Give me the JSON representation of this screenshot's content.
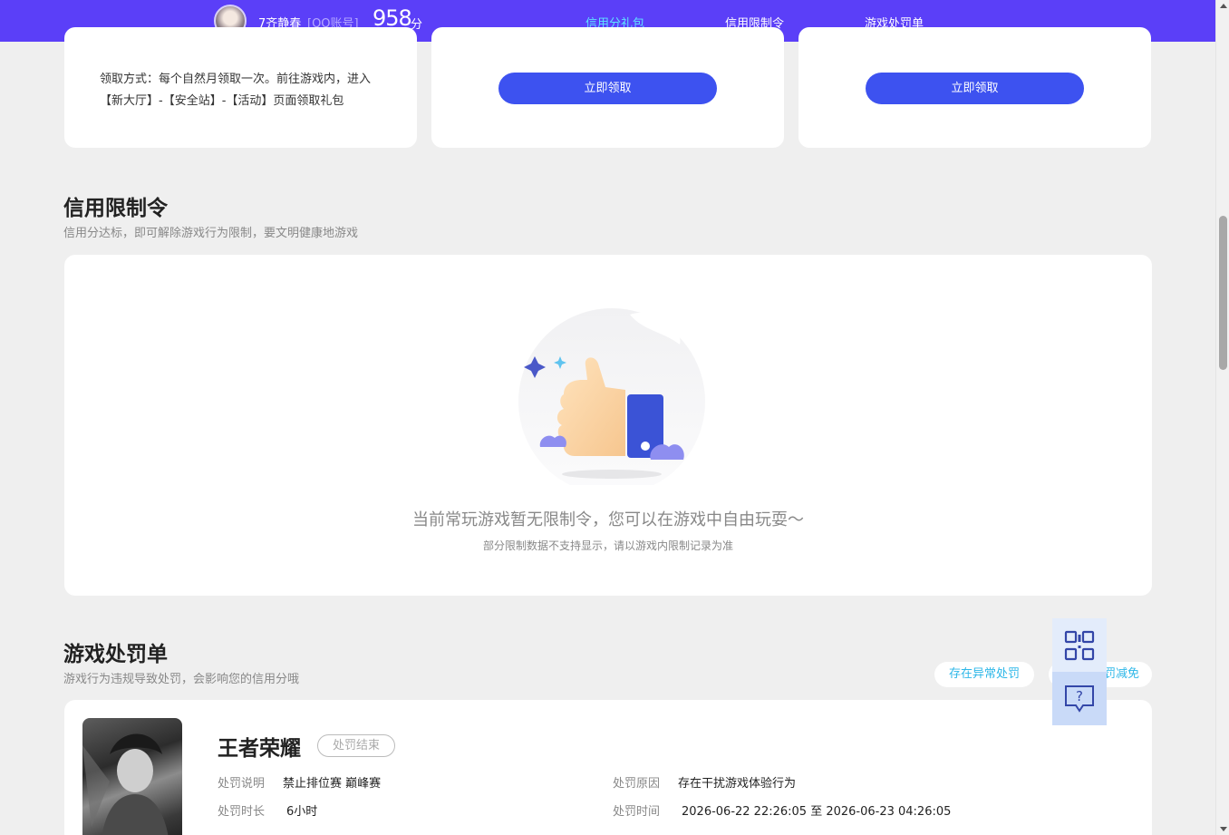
{
  "header": {
    "username": "7齐静春",
    "account_type": "[QQ账号]",
    "score": "958",
    "score_unit": "分",
    "tabs": [
      "信用分礼包",
      "信用限制令",
      "游戏处罚单"
    ],
    "active_tab": "信用分礼包"
  },
  "gifts": {
    "claim_method": "领取方式：每个自然月领取一次。前往游戏内，进入【新大厅】-【安全站】-【活动】页面领取礼包",
    "claim_button": "立即领取"
  },
  "restriction": {
    "title": "信用限制令",
    "subtitle": "信用分达标，即可解除游戏行为限制，要文明健康地游戏",
    "empty_message": "当前常玩游戏暂无限制令，您可以在游戏中自由玩耍～",
    "empty_note": "部分限制数据不支持显示，请以游戏内限制记录为准"
  },
  "penalty": {
    "title": "游戏处罚单",
    "subtitle": "游戏行为违规导致处罚，会影响您的信用分哦",
    "abnormal_button": "存在异常处罚",
    "reduce_button": "罚减免",
    "game_name": "王者荣耀",
    "status": "处罚结束",
    "desc_label": "处罚说明",
    "desc_value": "禁止排位赛 巅峰赛",
    "reason_label": "处罚原因",
    "reason_value": "存在干扰游戏体验行为",
    "duration_label": "处罚时长",
    "duration_value": "6小时",
    "time_label": "处罚时间",
    "time_value": "2026-06-22 22:26:05 至 2026-06-23 04:26:05"
  },
  "float_panel": {
    "icons": [
      "qr-code-icon",
      "help-chat-icon"
    ]
  },
  "colors": {
    "header_bg": "#5b3ff8",
    "active_tab": "#5fe4ff",
    "button": "#3d52f0",
    "pill_text": "#2db7e8"
  }
}
